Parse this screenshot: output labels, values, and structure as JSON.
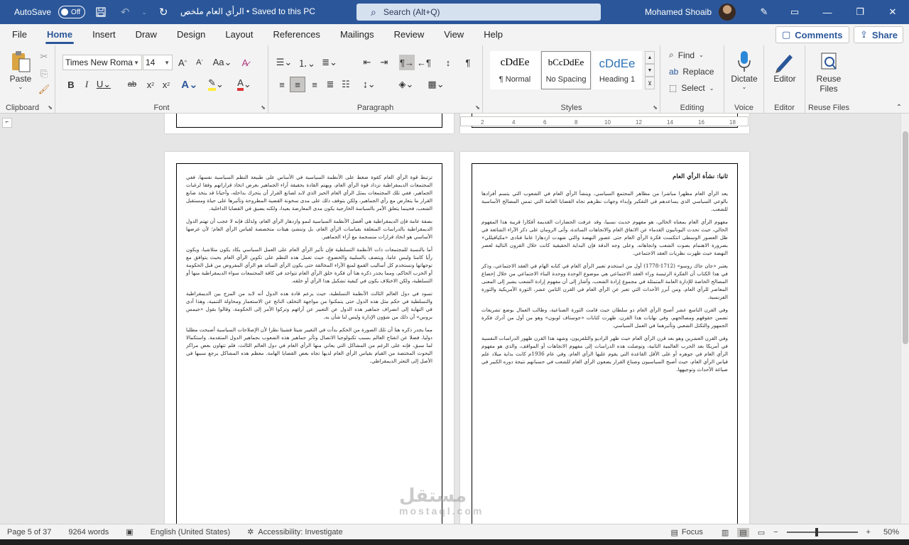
{
  "titlebar": {
    "autosave_label": "AutoSave",
    "autosave_state": "Off",
    "doc_title": "الرأي العام ملخص • Saved to this PC",
    "search_placeholder": "Search (Alt+Q)",
    "user_name": "Mohamed Shoaib"
  },
  "tabs": [
    "File",
    "Home",
    "Insert",
    "Draw",
    "Design",
    "Layout",
    "References",
    "Mailings",
    "Review",
    "View",
    "Help"
  ],
  "tab_actions": {
    "comments": "Comments",
    "share": "Share"
  },
  "ribbon": {
    "clipboard": {
      "label": "Clipboard",
      "paste": "Paste"
    },
    "font": {
      "label": "Font",
      "font_name": "Times New Roma",
      "font_size": "14"
    },
    "paragraph": {
      "label": "Paragraph"
    },
    "styles": {
      "label": "Styles",
      "items": [
        {
          "preview": "cDdEe",
          "name": "¶ Normal"
        },
        {
          "preview": "bCcDdEe",
          "name": "No Spacing"
        },
        {
          "preview": "cDdEe",
          "name": "Heading 1"
        }
      ]
    },
    "editing": {
      "label": "Editing",
      "find": "Find",
      "replace": "Replace",
      "select": "Select"
    },
    "voice": {
      "label": "Voice",
      "dictate": "Dictate"
    },
    "editor": {
      "label": "Editor",
      "editor": "Editor"
    },
    "reuse": {
      "label": "Reuse Files",
      "button": "Reuse Files"
    }
  },
  "ruler": {
    "ticks": [
      "2",
      "4",
      "6",
      "8",
      "10",
      "12",
      "14",
      "16",
      "18"
    ]
  },
  "pages": {
    "left": {
      "number": "7",
      "paragraphs": [
        "ترتبط قوة الرأي العام كقوة ضغط على الأنظمة السياسية في الأساس على طبيعة النظم السياسية نفسها، ففي المجتمعات الديمقراطية تزداد قوة الرأي العام، ويهتم القادة بحقيقة آراء الجماهير بغرض اتخاذ قراراتهم وفقا لرغبات الجماهير، ففي تلك المجتمعات يمثل الرأي العام الحيز الذي لابد لصانع القرار أن يتحرك بداخله، وأحيانا قد يتخذ صانع القرار ما يتعارض مع رأي الجماهير، ولكن يتوقف ذلك على مدى سخونة القضية المطروحة وتأثيرها على حياة ومستقبل الشعب، فحينما يتعلق الأمر بالسياسة الخارجية يكون مدى المعارضة بعيدا، ولكنه يضيق في القضايا الداخلية.",
        "بصفة عامة فإن الديمقراطية هي أفضل الأنظمة السياسية لنمو وازدهار الرأي العام، ولذلك فإنه لا عجب أن تهتم الدول الديمقراطية بالدراسات المتعلقة بقياسات الرأي العام، بل وتنشئ هيئات متخصصة لقياس الرأي العام؛ لأن غرضها الأساسي هو اتخاذ قرارات منسجمة مع آراء الجماهير.",
        "أما بالنسبة للمجتمعات ذات الأنظمة التسلطية فإن تأثير الرأي العام على العمل السياسي يكاد يكون متلاشيا، ويكون رأيا كامنا وليس عاما، ويتصف بالسلبية والخضوع، حيث تعمل هذه النظم على تكوين الرأي العام بحيث يتوافق مع توجهاتها وتستخدم كل أساليب القمع لمنع الآراء المخالفة حتى يكون الرأي السائد هو الرأي المفروض من قبل الحكومة أو الحزب الحاكم، ومما يجدر ذكره هنا أن فكرة خلق الرأي العام تتواجد في كافة المجتمعات سواء الديمقراطية منها أو التسلطية، ولكن الاختلاف يكون في كيفية تشكيل هذا الرأي أو خلقه.",
        "تسود في دول العالم الثالث الأنظمة التسلطية، حيث يزعم قادة هذه الدول أنه لابد من المزج بين الديمقراطية والتسلطية في حكم مثل هذه الدول حتى يتمكنوا من مواجهة التخلف الناتج عن الاستعمار ومحاولة التنمية، وهذا أدى في النهاية إلى انصراف جماهير هذه الدول عن التعبير عن آرائهم وتركوا الأمر إلى الحكومة، وقالوا بقول «جيمس بروس» أن ذلك من شؤون الإدارة وليس لنا شأن به.",
        "مما يجدر ذكره هنا أن تلك الصورة من الحكم بدأت في التغيير شيئا فشيئا نظرا لأن الإصلاحات السياسية أصبحت مطلبا دوليا، فضلا عن انفتاح العالم بسبب تكنولوجيا الاتصال وتأثر جماهير هذه الشعوب بجماهير الدول المتقدمة. واستكمالا لما سبق، فإنه على الرغم من المشاكل التي يعاني منها الرأي العام في دول العالم الثالث، فلم تتهاون بعض مراكز البحوث المختصة من القيام بقياس الرأي العام لديها تجاه بعض القضايا الهامة. معظم هذه المشاكل يرجع سببها في الأصل إلى التعثر الديمقراطي."
      ]
    },
    "right": {
      "number": "6",
      "heading": "ثانيا: نشأة الرأي العام",
      "paragraphs": [
        "يعد الرأي العام مظهرا مباشرا من مظاهر المجتمع السياسي، وينشأ الرأي العام في الشعوب التي يتسم أفرادها بالوعي السياسي الذي يساعدهم في التفكير وإبداء وجهات نظرهم تجاه القضايا العامة التي تمس المصالح الأساسية للشعب.",
        "مفهوم الرأي العام بمعناه الحالي، هو مفهوم حديث نسبيا، وقد عرفت الحضارات القديمة أفكارا قريبة هذا المفهوم الحالي، حيث تحدث اليونانيون القدماء عن الاتفاق العام والاتجاهات السائدة، وأتى الرومان على ذكر الآراء الشائعة في ظل العصور الوسطى انتكست فكرة الرأي العام حتى عصور النهضة والتي شهدت ازدهارا عاما فنادى «مكيافيللي» بضرورة الاهتمام بصوت الشعب واتجاهاته. وعلى وجه الدقة فإن البداية الحقيقية كانت خلال القرون التالية لعصر النهضة حيث ظهرت نظريات العقد الاجتماعي.",
        "يعتبر «جان جاك روسو» (1712-1778) أول من استخدم تعبير الرأي العام في كتابه الهام في العقد الاجتماعي، وذكر في هذا الكتاب أن الفكرة الرئيسة وراء العقد الاجتماعي هي موضوع الوحدة ووحدة البناء الاجتماعي من خلال إخضاع المصالح الخاصة للإدارة العامة المتمثلة في مجموع إرادة الشعب، وأشار إلى أن مفهوم إرادة الشعب يشير إلى المعنى المعاصر للرأي العام. ومن أبرز الأحداث التي تعبر عن الرأي العام في القرن الثامن عشر، الثورة الأمريكية والثورة الفرنسية.",
        "وفي القرن التاسع عشر أصبح الرأي العام ذو سلطان حيث قامت الثورة الصناعية، وطالب العمال بوضع تشريعات تضمن حقوقهم ومصالحهم، وفي نهايات هذا القرن، ظهرت كتابات «جوستاف لوبون» وهو من أول من أدرك فكرة الجمهور والتكتل الشعبي وتأثيرهما في العمل السياسي.",
        "وفي القرن العشرين وهو بعد قرن الرأي العام حيث ظهر الراديو والتلفزيون، وشهد هذا القرن ظهور الدراسات النفسية في أمريكا بعد الحرب العالمية الثانية، وتوصلت هذه الدراسات إلى مفهوم الاتجاهات أو المواقف، والذي هو مفهوم الرأي العام في جوهره أو على الأقل القاعدة التي يقوم عليها الرأي العام. وفي عام 1936م كانت بداية ميلاد علم قياس الرأي العام، حيث أصبح السياسيون وصناع القرار يضعون الرأي العام للشعب في حسبانهم نتيجة دوره الكبير في صياغة الأحداث وتوجيهها."
      ]
    }
  },
  "watermark": {
    "main": "مستقل",
    "sub": "mostaql.com"
  },
  "statusbar": {
    "page": "Page 5 of 37",
    "words": "9264 words",
    "language": "English (United States)",
    "accessibility": "Accessibility: Investigate",
    "focus": "Focus",
    "zoom": "50%"
  }
}
